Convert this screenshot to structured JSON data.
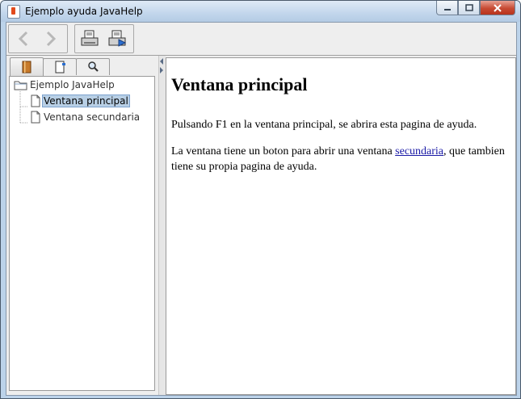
{
  "window": {
    "title": "Ejemplo ayuda JavaHelp",
    "app_icon": "java-cup-icon",
    "controls": {
      "minimize": "–",
      "maximize": "□",
      "close": "✕"
    }
  },
  "toolbar": {
    "buttons": [
      {
        "name": "back-button",
        "icon": "arrow-left-icon",
        "enabled": false
      },
      {
        "name": "forward-button",
        "icon": "arrow-right-icon",
        "enabled": false
      },
      {
        "name": "print-button",
        "icon": "printer-icon",
        "enabled": true
      },
      {
        "name": "page-setup-button",
        "icon": "printer-setup-icon",
        "enabled": true
      }
    ]
  },
  "navigator": {
    "tabs": [
      {
        "name": "toc",
        "icon": "book-icon",
        "active": true
      },
      {
        "name": "index",
        "icon": "index-book-icon",
        "active": false
      },
      {
        "name": "search",
        "icon": "magnifier-icon",
        "active": false
      }
    ],
    "tree": {
      "root": "Ejemplo JavaHelp",
      "items": [
        {
          "label": "Ventana principal",
          "selected": true
        },
        {
          "label": "Ventana secundaria",
          "selected": false
        }
      ]
    }
  },
  "content": {
    "heading": "Ventana principal",
    "p1": "Pulsando F1 en la ventana principal, se abrira esta pagina de ayuda.",
    "p2_before": "La ventana tiene un boton para abrir una ventana ",
    "p2_link": "secundaria",
    "p2_after": ", que tambien tiene su propia pagina de ayuda."
  },
  "colors": {
    "link": "#1a1aa6",
    "selection": "#b8cfe5",
    "titlebar": "#c2d6ec"
  }
}
